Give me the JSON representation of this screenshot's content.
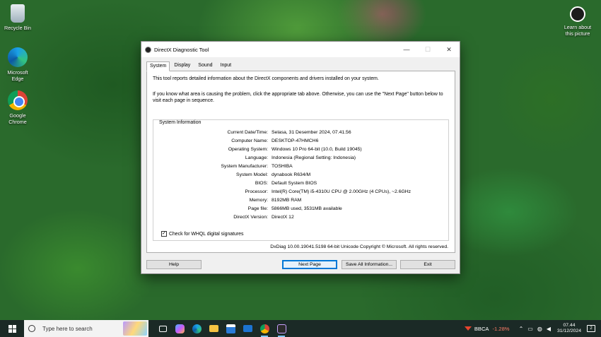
{
  "desktop": {
    "icons": [
      {
        "label": "Recycle Bin"
      },
      {
        "label": "Microsoft Edge"
      },
      {
        "label": "Google Chrome"
      }
    ],
    "learn": "Learn about this picture"
  },
  "window": {
    "title": "DirectX Diagnostic Tool",
    "controls": {
      "minimize": "—",
      "maximize": "☐",
      "close": "✕"
    },
    "tabs": [
      "System",
      "Display",
      "Sound",
      "Input"
    ],
    "active_tab": "System",
    "intro": "This tool reports detailed information about the DirectX components and drivers installed on your system.",
    "intro2": "If you know what area is causing the problem, click the appropriate tab above.  Otherwise, you can use the \"Next Page\" button below to visit each page in sequence.",
    "group_title": "System Information",
    "info": [
      {
        "label": "Current Date/Time:",
        "value": "Selasa, 31 Desember 2024, 07.41.56"
      },
      {
        "label": "Computer Name:",
        "value": "DESKTOP-47HMCH6"
      },
      {
        "label": "Operating System:",
        "value": "Windows 10 Pro 64-bit (10.0, Build 19045)"
      },
      {
        "label": "Language:",
        "value": "Indonesia (Regional Setting: Indonesia)"
      },
      {
        "label": "System Manufacturer:",
        "value": "TOSHIBA"
      },
      {
        "label": "System Model:",
        "value": "dynabook R634/M"
      },
      {
        "label": "BIOS:",
        "value": "Default System BIOS"
      },
      {
        "label": "Processor:",
        "value": "Intel(R) Core(TM) i5-4310U CPU @ 2.00GHz (4 CPUs), ~2.6GHz"
      },
      {
        "label": "Memory:",
        "value": "8192MB RAM"
      },
      {
        "label": "Page file:",
        "value": "5866MB used, 3531MB available"
      },
      {
        "label": "DirectX Version:",
        "value": "DirectX 12"
      }
    ],
    "whql_label": "Check for WHQL digital signatures",
    "whql_checked": true,
    "footer_note": "DxDiag 10.00.19041.5198 64-bit Unicode  Copyright © Microsoft. All rights reserved.",
    "buttons": {
      "help": "Help",
      "next": "Next Page",
      "save": "Save All Information...",
      "exit": "Exit"
    }
  },
  "taskbar": {
    "search_placeholder": "Type here to search",
    "stock_symbol": "BBCA",
    "stock_change": "-1.28%",
    "time": "07.44",
    "date": "31/12/2024",
    "notifications": "2"
  }
}
